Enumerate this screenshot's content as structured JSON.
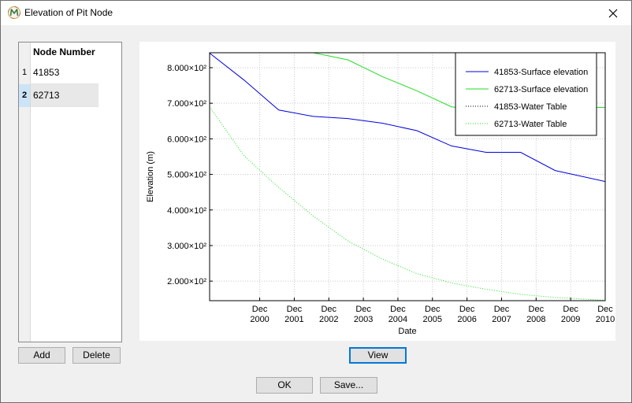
{
  "window": {
    "title": "Elevation of Pit Node",
    "icon": "app-logo-icon",
    "close_icon": "close-icon"
  },
  "table": {
    "header": "Node Number",
    "rows": [
      {
        "index": "1",
        "value": "41853",
        "selected": false
      },
      {
        "index": "2",
        "value": "62713",
        "selected": true
      }
    ],
    "add_label": "Add",
    "delete_label": "Delete"
  },
  "view_label": "View",
  "footer": {
    "ok_label": "OK",
    "save_label": "Save..."
  },
  "colors": {
    "blue": "#0000dd",
    "green": "#22dd22",
    "focus": "#0078d7",
    "select": "#cce4f7"
  },
  "chart_data": {
    "type": "line",
    "xlabel": "Date",
    "ylabel": "Elevation (m)",
    "xlim": [
      1999.5,
      2010.95
    ],
    "ylim": [
      145,
      842
    ],
    "y_ticks": [
      200,
      300,
      400,
      500,
      600,
      700,
      800
    ],
    "y_tick_labels": [
      "2.000×10²",
      "3.000×10²",
      "4.000×10²",
      "5.000×10²",
      "6.000×10²",
      "7.000×10²",
      "8.000×10²"
    ],
    "x_ticks": [
      2000.95,
      2001.95,
      2002.95,
      2003.95,
      2004.95,
      2005.95,
      2006.95,
      2007.95,
      2008.95,
      2009.95,
      2010.95
    ],
    "x_tick_labels": [
      {
        "month": "Dec",
        "year": "2000"
      },
      {
        "month": "Dec",
        "year": "2001"
      },
      {
        "month": "Dec",
        "year": "2002"
      },
      {
        "month": "Dec",
        "year": "2003"
      },
      {
        "month": "Dec",
        "year": "2004"
      },
      {
        "month": "Dec",
        "year": "2005"
      },
      {
        "month": "Dec",
        "year": "2006"
      },
      {
        "month": "Dec",
        "year": "2007"
      },
      {
        "month": "Dec",
        "year": "2008"
      },
      {
        "month": "Dec",
        "year": "2009"
      },
      {
        "month": "Dec",
        "year": "2010"
      }
    ],
    "grid": true,
    "legend_position": "top-right",
    "series": [
      {
        "name": "41853-Surface elevation",
        "color": "#0000dd",
        "style": "solid",
        "x": [
          1999.5,
          2000.5,
          2001.5,
          2002.5,
          2003.5,
          2004.5,
          2005.5,
          2006.5,
          2007.5,
          2008.5,
          2009.5,
          2010.95
        ],
        "y": [
          841,
          765,
          681,
          663,
          657,
          644,
          623,
          580,
          562,
          562,
          511,
          480
        ]
      },
      {
        "name": "62713-Surface elevation",
        "color": "#22dd22",
        "style": "solid",
        "x": [
          1999.5,
          2002.5,
          2003.5,
          2004.5,
          2005.5,
          2006.5,
          2007.5,
          2008.5,
          2009.5,
          2010.95
        ],
        "y": [
          842,
          842,
          822,
          775,
          735,
          690,
          680,
          675,
          690,
          688
        ]
      },
      {
        "name": "41853-Water Table",
        "color": "#000000",
        "style": "dotted",
        "x": [],
        "y": []
      },
      {
        "name": "62713-Water Table",
        "color": "#22dd22",
        "style": "dotted",
        "x": [
          1999.5,
          2000.5,
          2001.5,
          2002.5,
          2003.5,
          2004.5,
          2005.5,
          2006.5,
          2007.5,
          2008.5,
          2009.5,
          2010.95
        ],
        "y": [
          690,
          552,
          463,
          383,
          313,
          262,
          221,
          195,
          177,
          163,
          154,
          146
        ]
      }
    ]
  }
}
